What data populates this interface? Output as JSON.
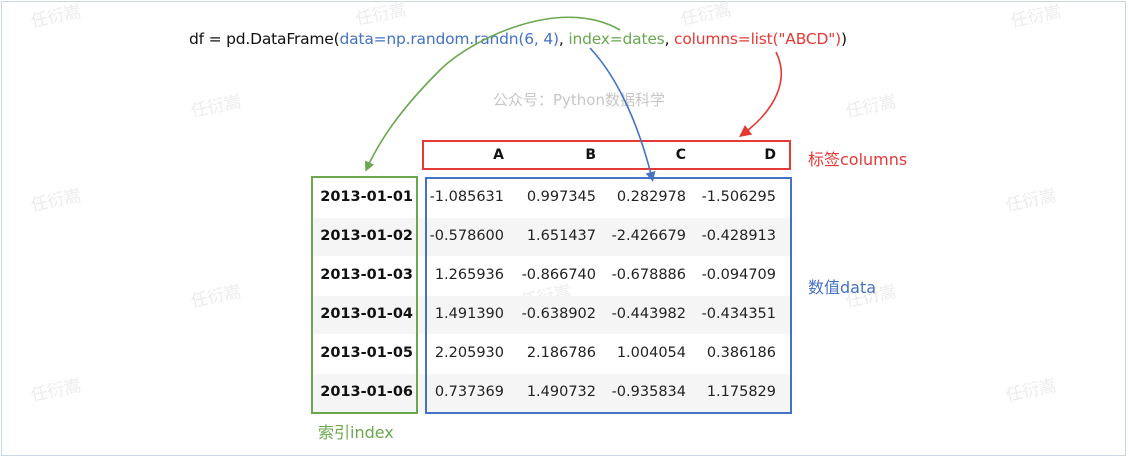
{
  "code_line": {
    "prefix": "df = pd.DataFrame(",
    "data_arg": "data=np.random.randn(6, 4)",
    "sep1": ", ",
    "index_arg": "index=dates",
    "sep2": ", ",
    "columns_arg": "columns=list(\"ABCD\")",
    "suffix": ")"
  },
  "watermark": {
    "center": "公众号：Python数据科学",
    "repeat": "任衍嵩"
  },
  "columns": [
    "A",
    "B",
    "C",
    "D"
  ],
  "rows": [
    {
      "index": "2013-01-01",
      "values": [
        "-1.085631",
        "0.997345",
        "0.282978",
        "-1.506295"
      ]
    },
    {
      "index": "2013-01-02",
      "values": [
        "-0.578600",
        "1.651437",
        "-2.426679",
        "-0.428913"
      ]
    },
    {
      "index": "2013-01-03",
      "values": [
        "1.265936",
        "-0.866740",
        "-0.678886",
        "-0.094709"
      ]
    },
    {
      "index": "2013-01-04",
      "values": [
        "1.491390",
        "-0.638902",
        "-0.443982",
        "-0.434351"
      ]
    },
    {
      "index": "2013-01-05",
      "values": [
        "2.205930",
        "2.186786",
        "1.004054",
        "0.386186"
      ]
    },
    {
      "index": "2013-01-06",
      "values": [
        "0.737369",
        "1.490732",
        "-0.935834",
        "1.175829"
      ]
    }
  ],
  "labels": {
    "columns": "标签columns",
    "data": "数值data",
    "index": "索引index"
  },
  "colors": {
    "columns": "#e53935",
    "data": "#4472c4",
    "index": "#6aa84f"
  }
}
